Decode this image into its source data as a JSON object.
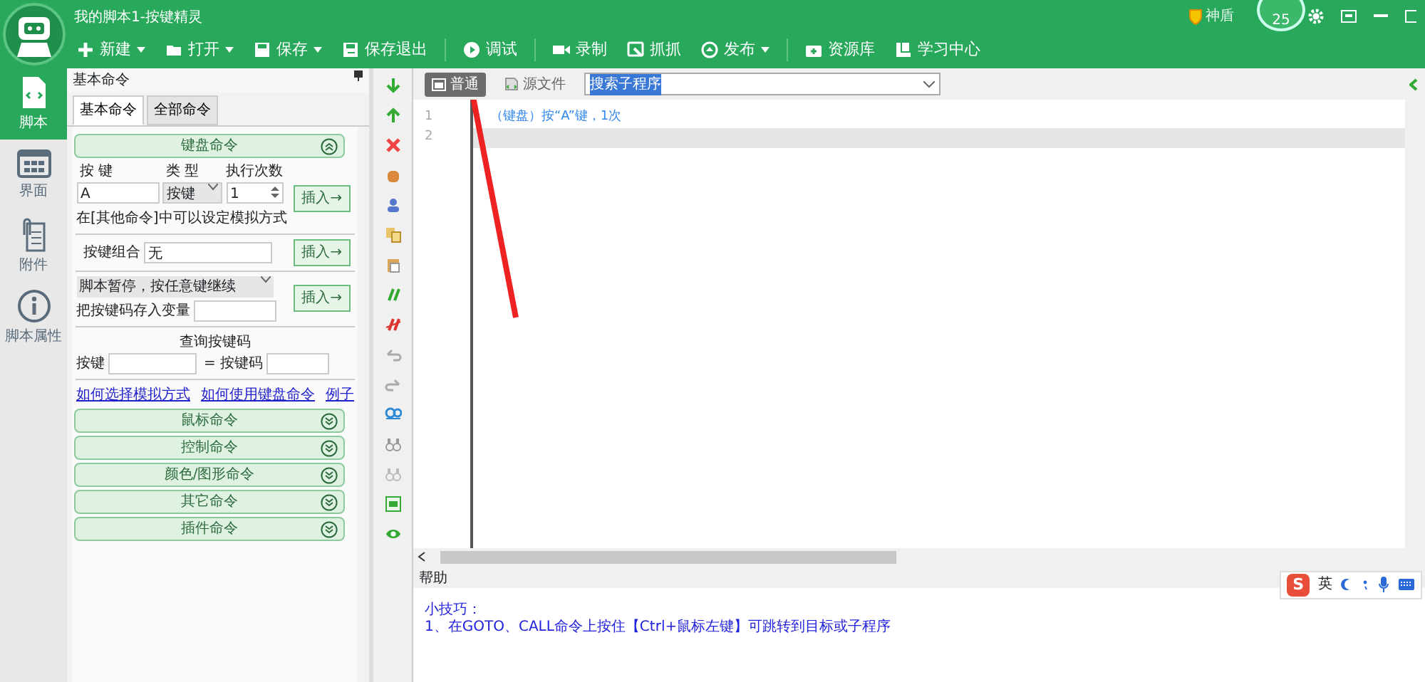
{
  "window": {
    "title": "我的脚本1-按键精灵",
    "user": "神盾",
    "level_badge": "25"
  },
  "toolbar": [
    {
      "label": "新建",
      "dropdown": true
    },
    {
      "label": "打开",
      "dropdown": true
    },
    {
      "label": "保存",
      "dropdown": true
    },
    {
      "label": "保存退出"
    },
    {
      "label": "调试",
      "sep": true
    },
    {
      "label": "录制",
      "sep": true
    },
    {
      "label": "抓抓"
    },
    {
      "label": "发布",
      "dropdown": true
    },
    {
      "label": "资源库",
      "sep": true
    },
    {
      "label": "学习中心"
    }
  ],
  "sidebar": {
    "items": [
      {
        "label": "脚本",
        "selected": true
      },
      {
        "label": "界面",
        "selected": false
      },
      {
        "label": "附件",
        "selected": false
      },
      {
        "label": "脚本属性",
        "selected": false
      }
    ]
  },
  "panel": {
    "title": "基本命令",
    "tabs": [
      {
        "label": "基本命令",
        "selected": true
      },
      {
        "label": "全部命令",
        "selected": false
      }
    ],
    "keyboard": {
      "header": "键盘命令",
      "expanded": true,
      "col_key": "按 键",
      "col_type": "类 型",
      "col_times": "执行次数",
      "key_value": "A",
      "type_value": "按键",
      "times_value": "1",
      "insert": "插入→",
      "note": "在[其他命令]中可以设定模拟方式",
      "combo_label": "按键组合",
      "combo_value": "无",
      "combo_insert": "插入→",
      "pause_value": "脚本暂停，按任意键继续",
      "store_label": "把按键码存入变量",
      "pause_insert": "插入→",
      "query_title": "查询按键码",
      "query_key": "按键",
      "query_code": "= 按键码",
      "links": [
        "如何选择模拟方式",
        "如何使用键盘命令",
        "例子"
      ]
    },
    "sections": [
      {
        "label": "鼠标命令",
        "expanded": false
      },
      {
        "label": "控制命令",
        "expanded": false
      },
      {
        "label": "颜色/图形命令",
        "expanded": false
      },
      {
        "label": "其它命令",
        "expanded": false
      },
      {
        "label": "插件命令",
        "expanded": false
      }
    ]
  },
  "editor": {
    "modes": [
      {
        "label": "普通",
        "selected": true
      },
      {
        "label": "源文件",
        "selected": false
      }
    ],
    "search": "搜索子程序",
    "lines": [
      {
        "number": "1",
        "text": "（键盘）按“A”键，1次"
      },
      {
        "number": "2"
      }
    ]
  },
  "help": {
    "title": "帮助",
    "tip_title": "小技巧：",
    "tip": "1、在GOTO、CALL命令上按住【Ctrl+鼠标左键】可跳转到目标或子程序"
  },
  "ime": {
    "logo": "S",
    "mode": "英"
  }
}
